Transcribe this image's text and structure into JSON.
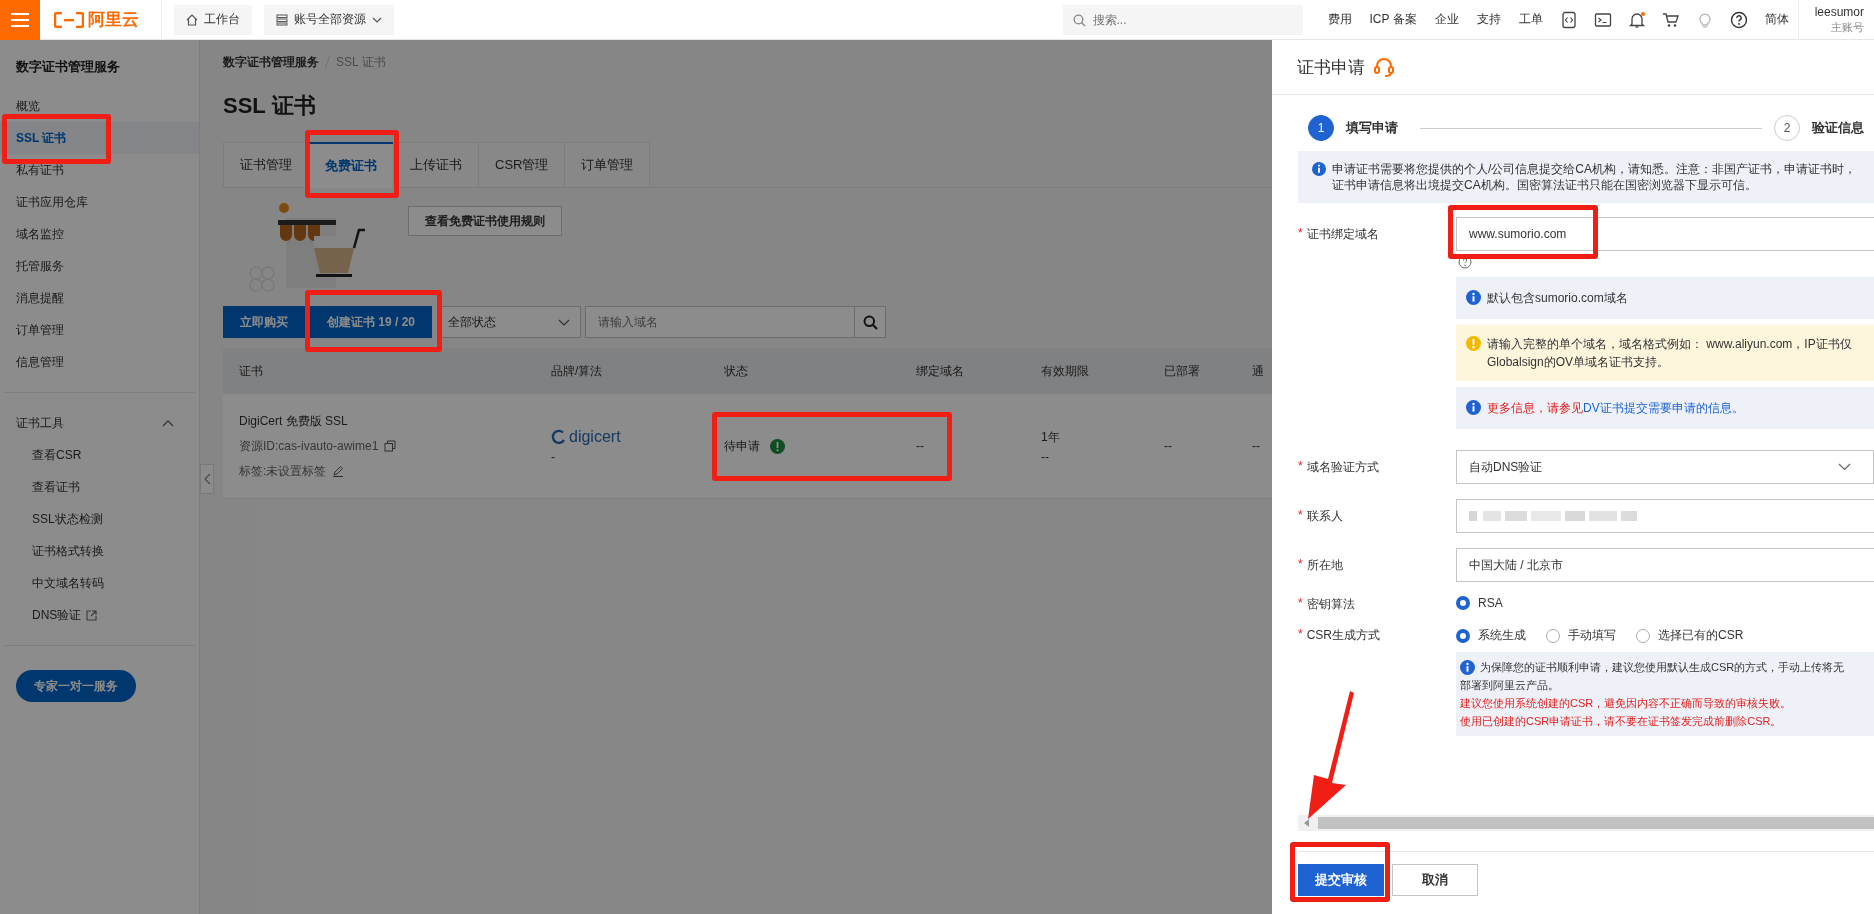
{
  "top_bar": {
    "logo": "阿里云",
    "nav": [
      {
        "label": "工作台",
        "kind": "home"
      },
      {
        "label": "账号全部资源",
        "kind": "resources"
      }
    ],
    "search": {
      "placeholder": "搜索..."
    },
    "links": [
      "费用",
      "ICP 备案",
      "企业",
      "支持",
      "工单"
    ],
    "language": "简体",
    "user": {
      "name": "leesumor",
      "role": "主账号"
    }
  },
  "sidebar": {
    "title": "数字证书管理服务",
    "items": [
      {
        "label": "概览",
        "selected": false,
        "highlighted": false
      },
      {
        "label": "SSL 证书",
        "selected": true,
        "highlighted": true
      },
      {
        "label": "私有证书",
        "selected": false,
        "highlighted": false
      },
      {
        "label": "证书应用仓库",
        "selected": false,
        "highlighted": false
      },
      {
        "label": "域名监控",
        "selected": false,
        "highlighted": false
      },
      {
        "label": "托管服务",
        "selected": false,
        "highlighted": false
      },
      {
        "label": "消息提醒",
        "selected": false,
        "highlighted": false
      },
      {
        "label": "订单管理",
        "selected": false,
        "highlighted": false
      },
      {
        "label": "信息管理",
        "selected": false,
        "highlighted": false
      }
    ],
    "tools": {
      "label": "证书工具",
      "expanded": true,
      "children": [
        {
          "label": "查看CSR",
          "external": false
        },
        {
          "label": "查看证书",
          "external": false
        },
        {
          "label": "SSL状态检测",
          "external": false
        },
        {
          "label": "证书格式转换",
          "external": false
        },
        {
          "label": "中文域名转码",
          "external": false
        },
        {
          "label": "DNS验证",
          "external": true
        }
      ]
    },
    "service_button": "专家一对一服务"
  },
  "main": {
    "breadcrumb": [
      "数字证书管理服务",
      "SSL 证书"
    ],
    "title": "SSL 证书",
    "tabs": [
      {
        "label": "证书管理",
        "selected": false,
        "highlighted": false
      },
      {
        "label": "免费证书",
        "selected": true,
        "highlighted": true
      },
      {
        "label": "上传证书",
        "selected": false,
        "highlighted": false
      },
      {
        "label": "CSR管理",
        "selected": false,
        "highlighted": false
      },
      {
        "label": "订单管理",
        "selected": false,
        "highlighted": false
      }
    ],
    "rules_button": "查看免费证书使用规则",
    "buy_button": "立即购买",
    "create_button": {
      "label": "创建证书 19 / 20",
      "highlighted": true
    },
    "status_filter": "全部状态",
    "domain_search": {
      "placeholder": "请输入域名"
    },
    "table": {
      "columns": [
        "证书",
        "品牌/算法",
        "状态",
        "绑定域名",
        "有效期限",
        "已部署",
        "通"
      ],
      "rows": [
        {
          "name": "DigiCert 免费版 SSL",
          "resource_id": "资源ID:cas-ivauto-awime1",
          "tag": "标签:未设置标签",
          "brand": "digicert",
          "algorithm": "-",
          "status": "待申请",
          "status_highlighted": true,
          "domain": "--",
          "validity": "1年",
          "validity_sub": "--",
          "deployed": "--",
          "column_7": "--"
        }
      ]
    }
  },
  "drawer": {
    "title": "证书申请",
    "steps": [
      {
        "number": "1",
        "label": "填写申请",
        "selected": true
      },
      {
        "number": "2",
        "label": "验证信息",
        "selected": false
      }
    ],
    "alert": "申请证书需要将您提供的个人/公司信息提交给CA机构，请知悉。注意：非国产证书，申请证书时，证书申请信息将出境提交CA机构。国密算法证书只能在国密浏览器下显示可信。",
    "form": [
      {
        "kind": "input",
        "required_mark": "*",
        "label": "证书绑定域名",
        "value": "www.sumorio.com",
        "highlighted": true,
        "notes": [
          {
            "kind": "info",
            "text": "默认包含sumorio.com域名"
          },
          {
            "kind": "warning",
            "text": "请输入完整的单个域名，域名格式例如： www.aliyun.com，IP证书仅Globalsign的OV单域名证书支持。"
          },
          {
            "kind": "info-link",
            "text": "更多信息，请参见",
            "link": "DV证书提交需要申请的信息。"
          }
        ]
      },
      {
        "kind": "select",
        "required_mark": "*",
        "label": "域名验证方式",
        "value": "自动DNS验证"
      },
      {
        "kind": "redacted",
        "required_mark": "*",
        "label": "联系人"
      },
      {
        "kind": "input",
        "required_mark": "*",
        "label": "所在地",
        "value": "中国大陆 / 北京市"
      },
      {
        "kind": "radio",
        "required_mark": "*",
        "label": "密钥算法",
        "options": [
          {
            "label": "RSA",
            "selected": true
          }
        ]
      },
      {
        "kind": "radio",
        "required_mark": "*",
        "label": "CSR生成方式",
        "options": [
          {
            "label": "系统生成",
            "selected": true
          },
          {
            "label": "手动填写",
            "selected": false
          },
          {
            "label": "选择已有的CSR",
            "selected": false
          }
        ],
        "note": {
          "lines": [
            "为保障您的证书顺利申请，建议您使用默认生成CSR的方式，手动上传将无",
            "部署到阿里云产品。"
          ],
          "warnings": [
            "建议您使用系统创建的CSR，避免因内容不正确而导致的审核失败。",
            "使用已创建的CSR申请证书，请不要在证书签发完成前删除CSR。"
          ]
        }
      }
    ],
    "buttons": [
      {
        "label": "提交审核",
        "kind": "primary",
        "highlighted": true
      },
      {
        "label": "取消",
        "kind": "default"
      }
    ]
  }
}
